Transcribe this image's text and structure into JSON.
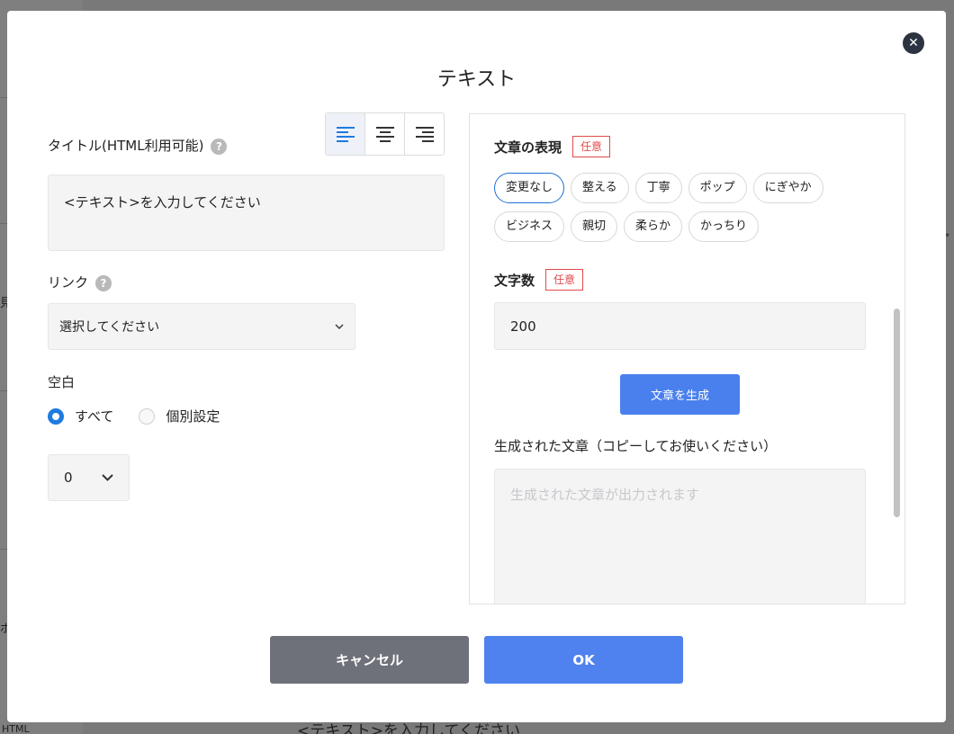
{
  "background": {
    "edge_texts": [
      "見",
      "ボ",
      "HTML",
      "*"
    ],
    "bottom_text": "<テキスト>を入力してください"
  },
  "modal": {
    "title": "テキスト",
    "close_icon": "close-circle-icon"
  },
  "left": {
    "title_label": "タイトル(HTML利用可能)",
    "help_glyph": "?",
    "align_buttons": [
      {
        "icon": "align-left-icon",
        "active": true
      },
      {
        "icon": "align-center-icon",
        "active": false
      },
      {
        "icon": "align-right-icon",
        "active": false
      }
    ],
    "title_value": "<テキスト>を入力してください",
    "link_label": "リンク",
    "link_select_value": "選択してください",
    "spacing_label": "空白",
    "radio_all": "すべて",
    "radio_individual": "個別設定",
    "spacing_value": "0"
  },
  "right": {
    "expression_label": "文章の表現",
    "optional_tag": "任意",
    "chips": [
      "変更なし",
      "整える",
      "丁寧",
      "ポップ",
      "にぎやか",
      "ビジネス",
      "親切",
      "柔らか",
      "かっちり"
    ],
    "selected_chip": "変更なし",
    "char_count_label": "文字数",
    "char_count_value": "200",
    "generate_button": "文章を生成",
    "generated_label": "生成された文章（コピーしてお使いください）",
    "generated_placeholder": "生成された文章が出力されます"
  },
  "footer": {
    "cancel": "キャンセル",
    "ok": "OK"
  },
  "colors": {
    "accent": "#4f82ee",
    "radio_selected": "#1e7be0",
    "optional_tag": "#e34a4a",
    "cancel_button": "#6e717a"
  }
}
